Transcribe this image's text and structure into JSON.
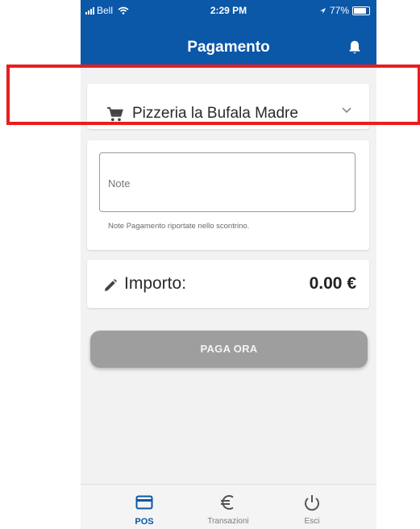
{
  "status_bar": {
    "carrier": "Bell",
    "time": "2:29 PM",
    "battery": "77%"
  },
  "header": {
    "title": "Pagamento",
    "notification_icon": "bell-icon"
  },
  "shop_selector": {
    "name": "Pizzeria la Bufala Madre",
    "icon": "cart-icon",
    "chevron": "chevron-down-icon"
  },
  "note": {
    "placeholder": "Note",
    "value": "",
    "helper": "Note Pagamento riportate nello scontrino."
  },
  "amount": {
    "label": "Importo:",
    "value": "0.00 €",
    "icon": "pencil-icon"
  },
  "pay_button": {
    "label": "PAGA ORA"
  },
  "bottom_nav": {
    "items": [
      {
        "label": "POS",
        "icon": "card-icon",
        "active": true
      },
      {
        "label": "Transazioni",
        "icon": "euro-icon",
        "active": false
      },
      {
        "label": "Esci",
        "icon": "power-icon",
        "active": false
      }
    ]
  },
  "colors": {
    "primary": "#0b57a8",
    "button_disabled": "#9e9e9e",
    "highlight": "#e81d1d"
  }
}
